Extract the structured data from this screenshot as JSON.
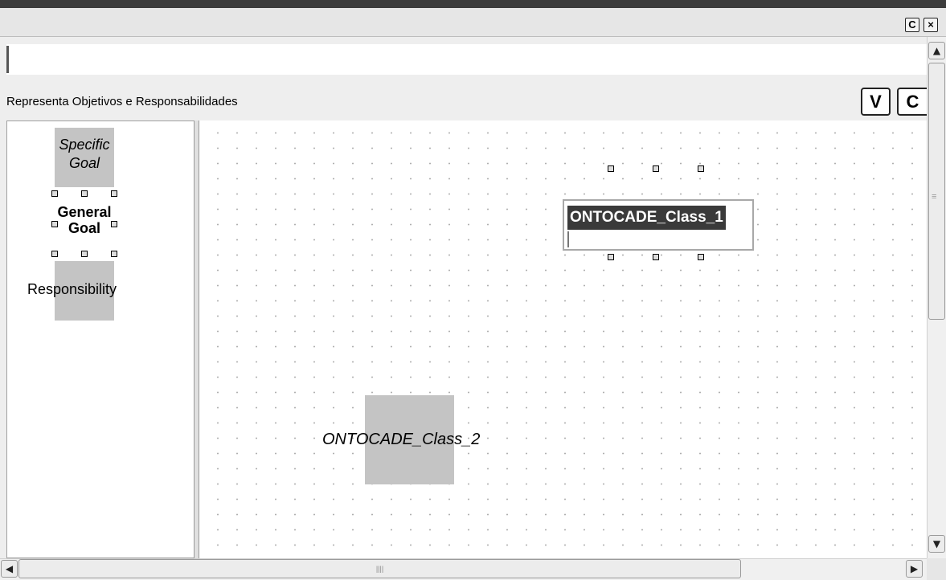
{
  "window": {
    "restore_button_label": "C",
    "close_button_label": "×"
  },
  "palette_header": {
    "label": "Representa Objetivos e Responsabilidades",
    "v_button_label": "V",
    "c_button_label": "C"
  },
  "palette": {
    "items": [
      {
        "label_line1": "Specific",
        "label_line2": "Goal"
      },
      {
        "label_line1": "General",
        "label_line2": "Goal"
      },
      {
        "label_line1": "Responsibility"
      }
    ]
  },
  "canvas": {
    "class1_label": "ONTOCADE_Class_1",
    "class2_label": "ONTOCADE_Class_2"
  },
  "scrollbars": {
    "up_arrow": "▲",
    "down_arrow": "▼",
    "left_arrow": "◀",
    "right_arrow": "▶",
    "grip": "≡",
    "h_grip": "||||"
  }
}
